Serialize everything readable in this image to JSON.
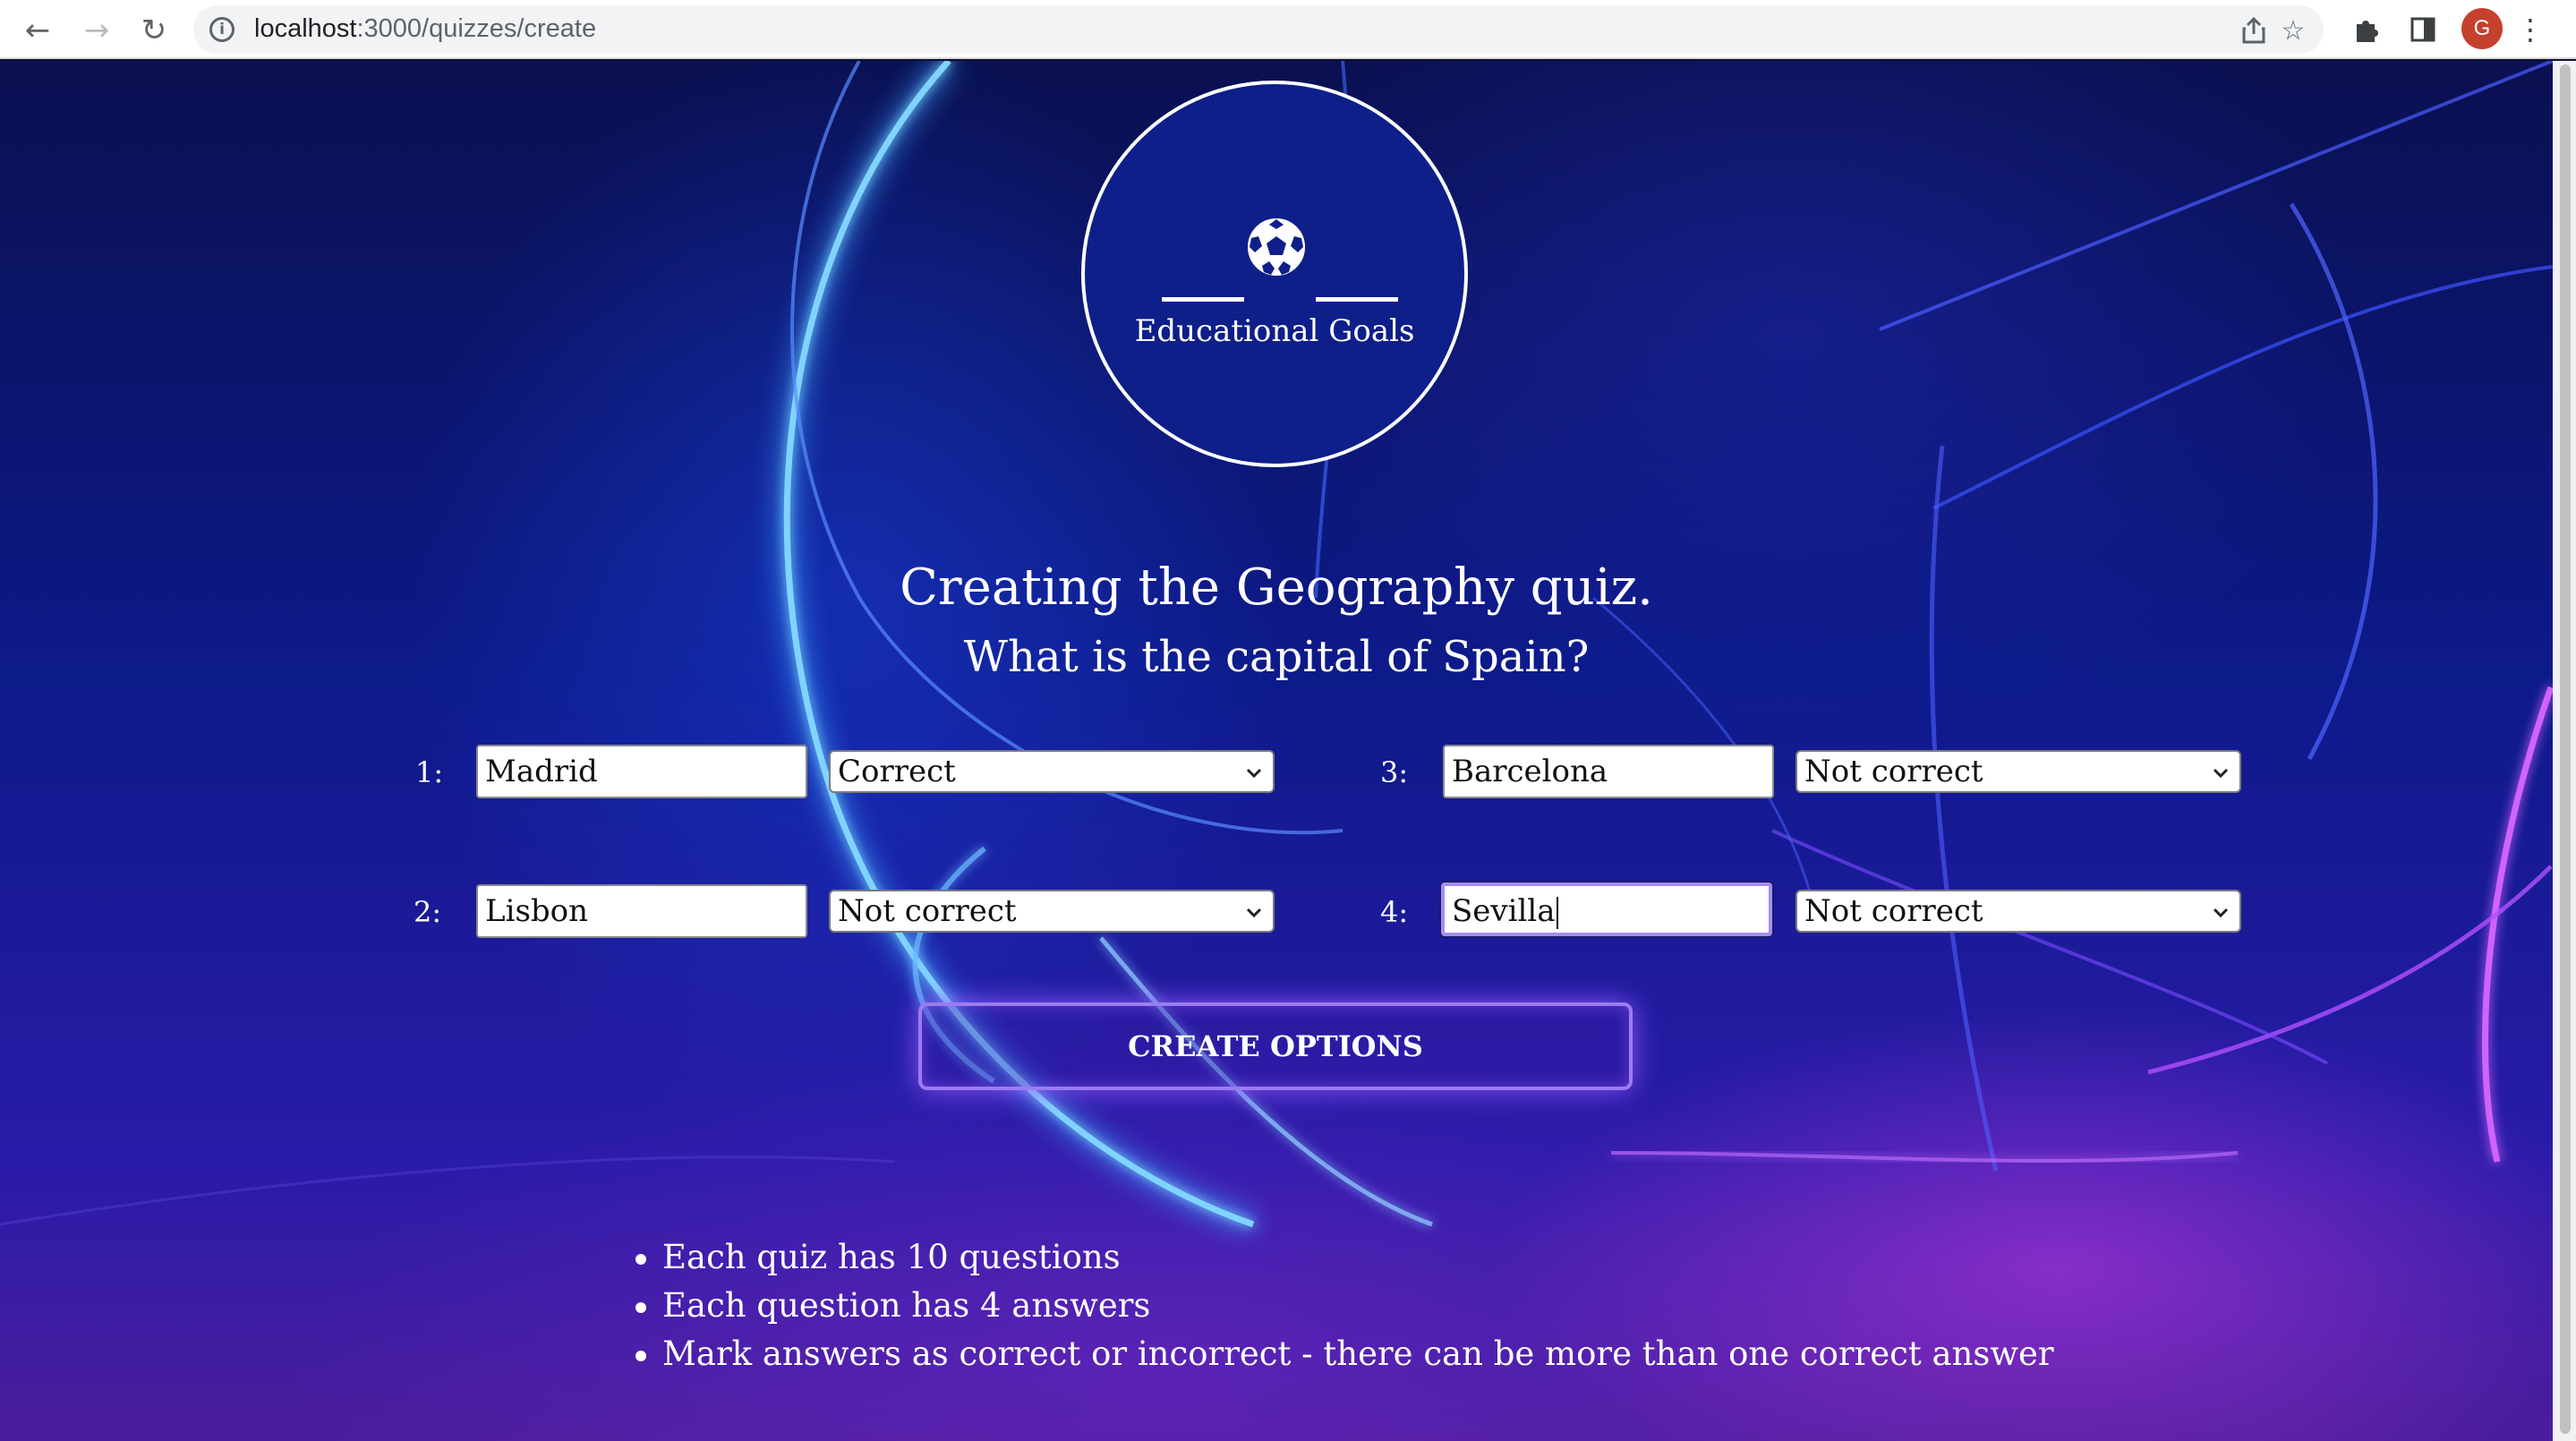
{
  "browser": {
    "url_host": "localhost",
    "url_path": ":3000/quizzes/create",
    "avatar_letter": "G"
  },
  "logo": {
    "text": "Educational Goals",
    "icon": "soccer-ball-icon"
  },
  "quiz": {
    "title": "Creating the Geography quiz.",
    "question": "What is the capital of Spain?"
  },
  "answers": [
    {
      "number": "1:",
      "value": "Madrid",
      "status": "Correct"
    },
    {
      "number": "2:",
      "value": "Lisbon",
      "status": "Not correct"
    },
    {
      "number": "3:",
      "value": "Barcelona",
      "status": "Not correct"
    },
    {
      "number": "4:",
      "value": "Sevilla",
      "status": "Not correct"
    }
  ],
  "create_button": {
    "label": "CREATE OPTIONS"
  },
  "rules": [
    "Each quiz has 10 questions",
    "Each question has 4 answers",
    "Mark answers as correct or incorrect - there can be more than one correct answer"
  ],
  "colors": {
    "accent_glow": "#9b7cf0",
    "logo_fill": "#0e1f8a",
    "avatar": "#c5412d"
  }
}
